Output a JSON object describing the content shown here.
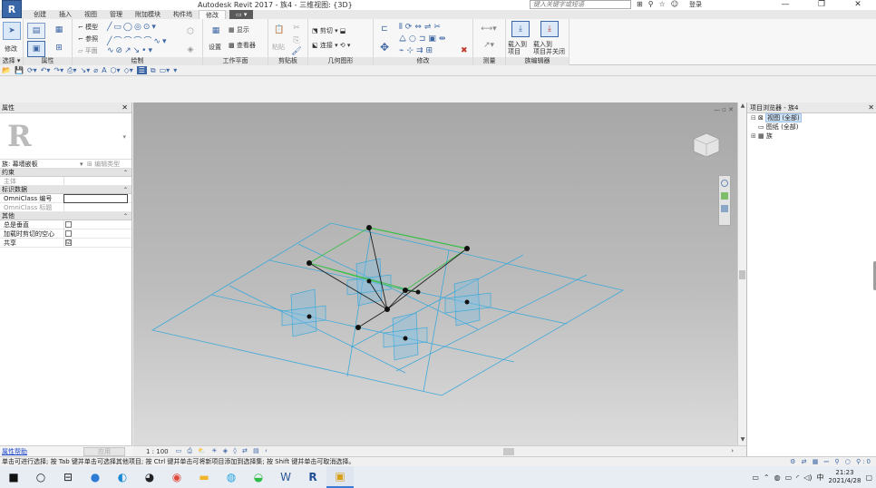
{
  "title_bar": {
    "app_button": "R",
    "title": "Autodesk Revit 2017 -   族4 - 三维视图: {3D}",
    "search_placeholder": "键入关键字或短语",
    "login": "登录",
    "window_buttons": [
      "—",
      "❐",
      "✕"
    ]
  },
  "ribbon_tabs": [
    "创建",
    "插入",
    "视图",
    "管理",
    "附加模块",
    "构件坞",
    "修改",
    "▭ ▾"
  ],
  "active_tab": "修改",
  "ribbon": {
    "panels": [
      "选择 ▾",
      "属性",
      "绘制",
      "工作平面",
      "剪贴板",
      "几何图形",
      "修改",
      "测量",
      "族编辑器"
    ],
    "buttons": {
      "modify": "修改",
      "model": "模型",
      "reference": "参照",
      "plane": "平面",
      "set": "设置",
      "show": "显示",
      "viewer": "查看器",
      "paste": "粘贴",
      "cut": "剪切",
      "join": "连接",
      "load_project": "载入到\n项目",
      "load_close": "载入到\n项目并关闭"
    }
  },
  "properties": {
    "header": "属性",
    "type_selector": "族: 幕墙嵌板",
    "edit_type": "编辑类型",
    "groups": [
      {
        "name": "约束",
        "rows": [
          {
            "label": "主体",
            "value": "",
            "kind": "text",
            "dim": true
          }
        ]
      },
      {
        "name": "标识数据",
        "rows": [
          {
            "label": "OmniClass 编号",
            "value": "",
            "kind": "edit",
            "dim": false
          },
          {
            "label": "OmniClass 标题",
            "value": "",
            "kind": "text",
            "dim": true
          }
        ]
      },
      {
        "name": "其他",
        "rows": [
          {
            "label": "总是垂直",
            "value": "",
            "kind": "checkbox",
            "checked": false
          },
          {
            "label": "加载时剪切的空心",
            "value": "",
            "kind": "checkbox",
            "checked": false
          },
          {
            "label": "共享",
            "value": "☑",
            "kind": "checkbox",
            "checked": true
          }
        ]
      }
    ],
    "help_link": "属性帮助",
    "apply": "应用"
  },
  "view_bar": {
    "scale": "1 : 100"
  },
  "project_browser": {
    "header": "项目浏览器 - 族4",
    "items": [
      {
        "expander": "⊟",
        "label": "视图 (全部)",
        "selected": true
      },
      {
        "expander": "",
        "label": "图纸 (全部)",
        "selected": false
      },
      {
        "expander": "⊞",
        "label": "族",
        "selected": false
      }
    ]
  },
  "status_bar": {
    "text": "单击可进行选择; 按 Tab 键并单击可选择其他项目; 按 Ctrl 键并单击可将新项目添加到选择集; 按 Shift 键并单击可取消选择。",
    "right": "⚲:0"
  },
  "taskbar": {
    "clock_time": "21:23",
    "clock_date": "2021/4/28",
    "ime": "中"
  }
}
